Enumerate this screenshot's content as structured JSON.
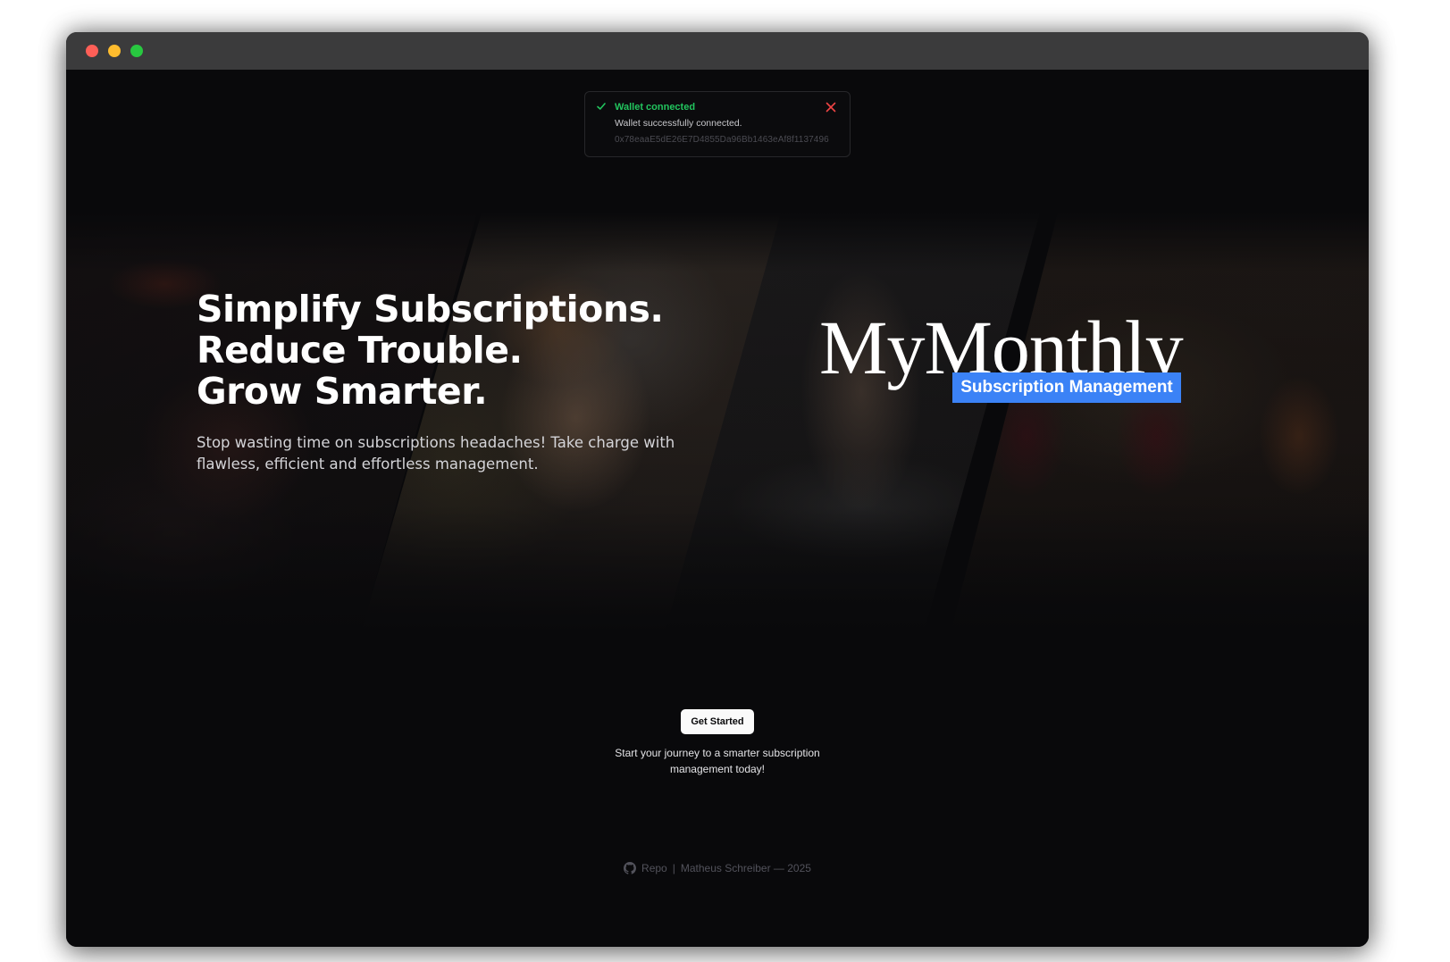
{
  "window": {
    "controls": [
      "close",
      "minimize",
      "maximize"
    ]
  },
  "toast": {
    "title": "Wallet connected",
    "description": "Wallet successfully connected.",
    "address": "0x78eaaE5dE26E7D4855Da96Bb1463eAf8f1137496",
    "status_icon": "check-icon",
    "close_icon": "close-icon",
    "title_color": "#22c55e",
    "close_color": "#ef4444"
  },
  "hero": {
    "headline_lines": [
      "Simplify Subscriptions.",
      "Reduce Trouble.",
      "Grow Smarter."
    ],
    "subtext": "Stop wasting time on subscriptions headaches! Take charge with flawless, efficient and effortless management."
  },
  "logo": {
    "wordmark": "MyMonthly",
    "tagline": "Subscription Management",
    "badge_color": "#3b82f6"
  },
  "cta": {
    "button_label": "Get Started",
    "caption": "Start your journey to a smarter subscription management today!"
  },
  "footer": {
    "repo_label": "Repo",
    "separator": "|",
    "credit": "Matheus Schreiber — 2025",
    "icon": "github-icon"
  },
  "theme": {
    "background": "#09090b",
    "accent": "#3b82f6"
  }
}
